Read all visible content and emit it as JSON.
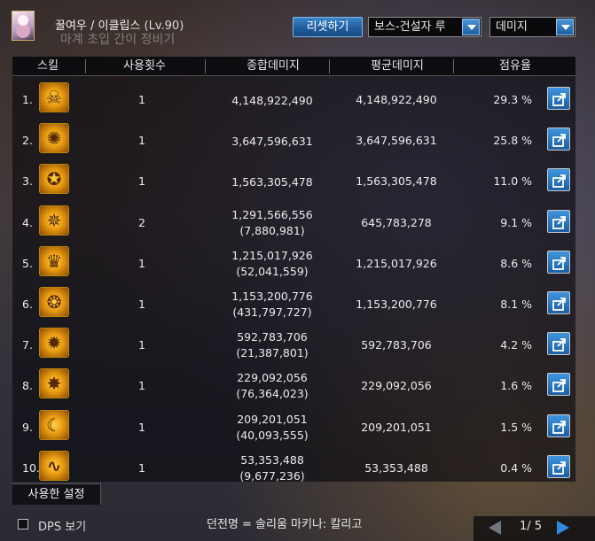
{
  "header": {
    "character_name": "꿀여우 / 이클립스",
    "level": "(Lv.90)",
    "background_text": "마계 초입 간이 정비기",
    "reset_label": "리셋하기",
    "boss_select_value": "보스-건설자 루",
    "type_select_value": "데미지"
  },
  "table": {
    "headers": [
      "스킬",
      "사용횟수",
      "종합데미지",
      "평균데미지",
      "점유율"
    ],
    "rows": [
      {
        "rank": "1.",
        "icon": "flame-skull-icon",
        "count": "1",
        "total": "4,148,922,490",
        "total_sub": "",
        "avg": "4,148,922,490",
        "share": "29.3 %"
      },
      {
        "rank": "2.",
        "icon": "swirl-icon",
        "count": "1",
        "total": "3,647,596,631",
        "total_sub": "",
        "avg": "3,647,596,631",
        "share": "25.8 %"
      },
      {
        "rank": "3.",
        "icon": "orb-slash-icon",
        "count": "1",
        "total": "1,563,305,478",
        "total_sub": "",
        "avg": "1,563,305,478",
        "share": "11.0 %"
      },
      {
        "rank": "4.",
        "icon": "rune-circle-icon",
        "count": "2",
        "total": "1,291,566,556",
        "total_sub": "(7,880,981)",
        "avg": "645,783,278",
        "share": "9.1 %"
      },
      {
        "rank": "5.",
        "icon": "crown-icon",
        "count": "1",
        "total": "1,215,017,926",
        "total_sub": "(52,041,559)",
        "avg": "1,215,017,926",
        "share": "8.6 %"
      },
      {
        "rank": "6.",
        "icon": "dragon-icon",
        "count": "1",
        "total": "1,153,200,776",
        "total_sub": "(431,797,727)",
        "avg": "1,153,200,776",
        "share": "8.1 %"
      },
      {
        "rank": "7.",
        "icon": "ring-burst-icon",
        "count": "1",
        "total": "592,783,706",
        "total_sub": "(21,387,801)",
        "avg": "592,783,706",
        "share": "4.2 %"
      },
      {
        "rank": "8.",
        "icon": "explosion-icon",
        "count": "1",
        "total": "229,092,056",
        "total_sub": "(76,364,023)",
        "avg": "229,092,056",
        "share": "1.6 %"
      },
      {
        "rank": "9.",
        "icon": "crescent-icon",
        "count": "1",
        "total": "209,201,051",
        "total_sub": "(40,093,555)",
        "avg": "209,201,051",
        "share": "1.5 %"
      },
      {
        "rank": "10.",
        "icon": "whip-icon",
        "count": "1",
        "total": "53,353,488",
        "total_sub": "(9,677,236)",
        "avg": "53,353,488",
        "share": "0.4 %"
      }
    ],
    "row_glyphs": [
      "☠",
      "✺",
      "✪",
      "✵",
      "♛",
      "❂",
      "✹",
      "✸",
      "☾",
      "∿"
    ]
  },
  "footer": {
    "used_settings_tab": "사용한 설정",
    "dps_label": "DPS 보기",
    "dungeon_label": "던전명 = 솔리움 마키나: 칼리고",
    "page_indicator": "1/ 5"
  },
  "colors": {
    "accent_blue": "#2f8ae0",
    "icon_gold": "#e89a10"
  }
}
